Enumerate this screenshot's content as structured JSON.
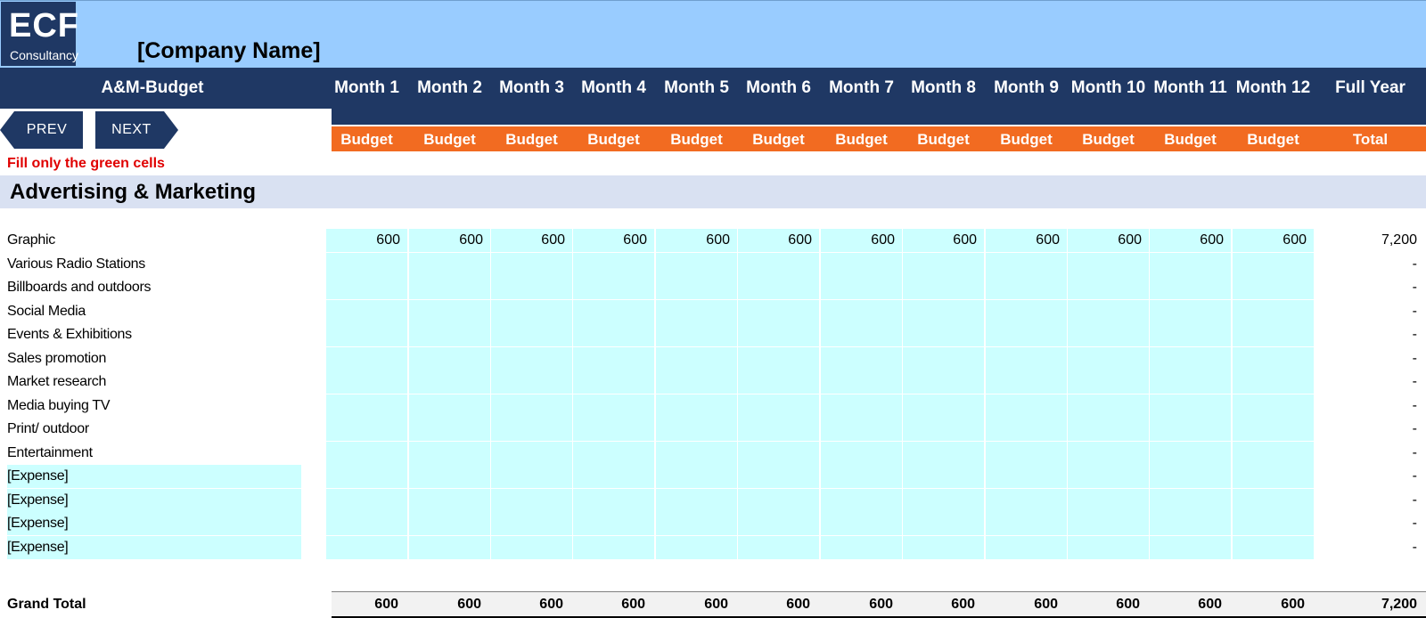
{
  "logo": {
    "main": "ECF",
    "sub": "Consultancy"
  },
  "company_name": "[Company Name]",
  "sheet_title": "A&M-Budget",
  "columns": [
    "Month 1",
    "Month 2",
    "Month 3",
    "Month 4",
    "Month 5",
    "Month 6",
    "Month 7",
    "Month 8",
    "Month 9",
    "Month 10",
    "Month 11",
    "Month 12",
    "Full Year"
  ],
  "subheaders": [
    "Budget",
    "Budget",
    "Budget",
    "Budget",
    "Budget",
    "Budget",
    "Budget",
    "Budget",
    "Budget",
    "Budget",
    "Budget",
    "Budget",
    "Total"
  ],
  "nav": {
    "prev": "PREV",
    "next": "NEXT"
  },
  "instruction": "Fill only the green cells",
  "section_title": "Advertising & Marketing",
  "rows": [
    {
      "label": "Graphic",
      "values": [
        "600",
        "600",
        "600",
        "600",
        "600",
        "600",
        "600",
        "600",
        "600",
        "600",
        "600",
        "600"
      ],
      "total": "7,200",
      "label_input": false
    },
    {
      "label": "Various Radio Stations",
      "values": [
        "",
        "",
        "",
        "",
        "",
        "",
        "",
        "",
        "",
        "",
        "",
        ""
      ],
      "total": "-",
      "label_input": false
    },
    {
      "label": "Billboards and outdoors",
      "values": [
        "",
        "",
        "",
        "",
        "",
        "",
        "",
        "",
        "",
        "",
        "",
        ""
      ],
      "total": "-",
      "label_input": false
    },
    {
      "label": "Social Media",
      "values": [
        "",
        "",
        "",
        "",
        "",
        "",
        "",
        "",
        "",
        "",
        "",
        ""
      ],
      "total": "-",
      "label_input": false
    },
    {
      "label": "Events & Exhibitions",
      "values": [
        "",
        "",
        "",
        "",
        "",
        "",
        "",
        "",
        "",
        "",
        "",
        ""
      ],
      "total": "-",
      "label_input": false
    },
    {
      "label": "Sales promotion",
      "values": [
        "",
        "",
        "",
        "",
        "",
        "",
        "",
        "",
        "",
        "",
        "",
        ""
      ],
      "total": "-",
      "label_input": false
    },
    {
      "label": "Market research",
      "values": [
        "",
        "",
        "",
        "",
        "",
        "",
        "",
        "",
        "",
        "",
        "",
        ""
      ],
      "total": "-",
      "label_input": false
    },
    {
      "label": "Media buying TV",
      "values": [
        "",
        "",
        "",
        "",
        "",
        "",
        "",
        "",
        "",
        "",
        "",
        ""
      ],
      "total": "-",
      "label_input": false
    },
    {
      "label": "Print/ outdoor",
      "values": [
        "",
        "",
        "",
        "",
        "",
        "",
        "",
        "",
        "",
        "",
        "",
        ""
      ],
      "total": "-",
      "label_input": false
    },
    {
      "label": "Entertainment",
      "values": [
        "",
        "",
        "",
        "",
        "",
        "",
        "",
        "",
        "",
        "",
        "",
        ""
      ],
      "total": "-",
      "label_input": false
    },
    {
      "label": "[Expense]",
      "values": [
        "",
        "",
        "",
        "",
        "",
        "",
        "",
        "",
        "",
        "",
        "",
        ""
      ],
      "total": "-",
      "label_input": true
    },
    {
      "label": "[Expense]",
      "values": [
        "",
        "",
        "",
        "",
        "",
        "",
        "",
        "",
        "",
        "",
        "",
        ""
      ],
      "total": "-",
      "label_input": true
    },
    {
      "label": "[Expense]",
      "values": [
        "",
        "",
        "",
        "",
        "",
        "",
        "",
        "",
        "",
        "",
        "",
        ""
      ],
      "total": "-",
      "label_input": true
    },
    {
      "label": "[Expense]",
      "values": [
        "",
        "",
        "",
        "",
        "",
        "",
        "",
        "",
        "",
        "",
        "",
        ""
      ],
      "total": "-",
      "label_input": true
    }
  ],
  "grand_total": {
    "label": "Grand Total",
    "values": [
      "600",
      "600",
      "600",
      "600",
      "600",
      "600",
      "600",
      "600",
      "600",
      "600",
      "600",
      "600"
    ],
    "total": "7,200"
  },
  "colors": {
    "banner": "#99ccff",
    "navy": "#1f3864",
    "orange": "#f26b21",
    "input_cell": "#ccffff",
    "section_band": "#d9e1f2",
    "instruction": "#e00000"
  }
}
